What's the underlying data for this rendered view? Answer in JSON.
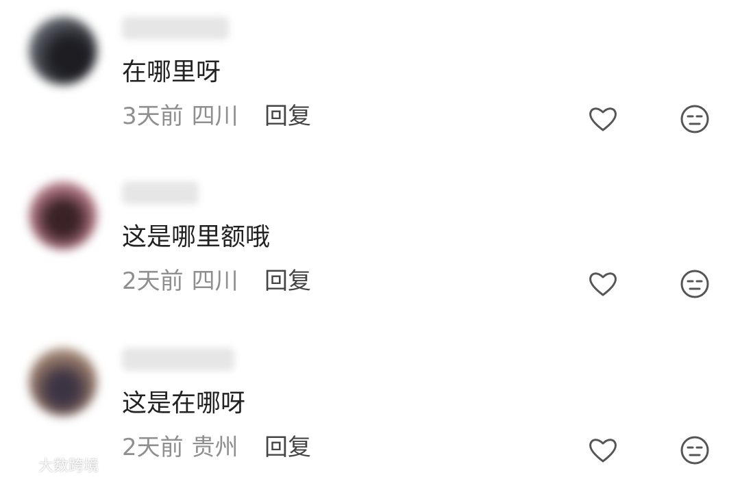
{
  "comments": [
    {
      "text": "在哪里呀",
      "time": "3天前",
      "location": "四川",
      "reply_label": "回复",
      "avatar_colors": [
        "#1d1d22",
        "#8a8f99"
      ]
    },
    {
      "text": "这是哪里额哦",
      "time": "2天前",
      "location": "四川",
      "reply_label": "回复",
      "avatar_colors": [
        "#3a2227",
        "#e6c5cc"
      ]
    },
    {
      "text": "这是在哪呀",
      "time": "2天前",
      "location": "贵州",
      "reply_label": "回复",
      "avatar_colors": [
        "#3d3443",
        "#d9c6a8"
      ]
    }
  ],
  "icons": {
    "like": "heart-outline-icon",
    "react": "neutral-face-icon"
  },
  "watermark": {
    "text": "大数跨境"
  },
  "colors": {
    "text": "#222222",
    "meta": "#8f8f8f",
    "reply": "#444444",
    "icon": "#555555"
  }
}
